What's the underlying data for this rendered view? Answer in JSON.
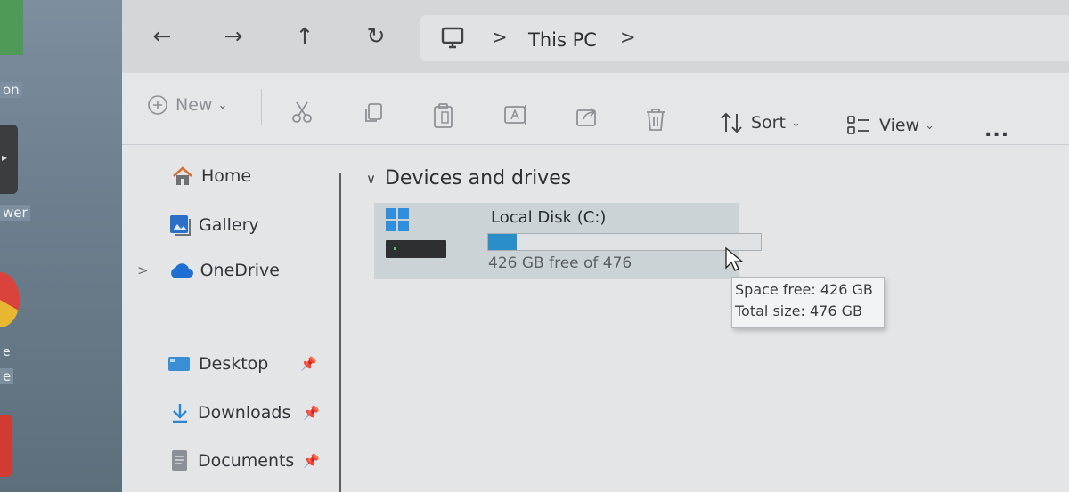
{
  "desktop": {
    "labels": [
      "on",
      "wer",
      "e",
      "e"
    ]
  },
  "nav_buttons": [
    "back",
    "forward",
    "up",
    "refresh"
  ],
  "address_bar": {
    "crumb": "This PC",
    "separator": ">"
  },
  "toolbar": {
    "new_label": "New",
    "sort_label": "Sort",
    "view_label": "View",
    "more_label": "..."
  },
  "nav_pane": {
    "items": [
      {
        "label": "Home",
        "icon": "home-icon",
        "pinned": false
      },
      {
        "label": "Gallery",
        "icon": "gallery-icon",
        "pinned": false
      },
      {
        "label": "OneDrive",
        "icon": "cloud-icon",
        "pinned": false,
        "expandable": true
      },
      {
        "label": "Desktop",
        "icon": "desktop-folder-icon",
        "pinned": true
      },
      {
        "label": "Downloads",
        "icon": "download-icon",
        "pinned": true
      },
      {
        "label": "Documents",
        "icon": "document-icon",
        "pinned": true
      }
    ]
  },
  "content": {
    "group_title": "Devices and drives",
    "drive": {
      "name": "Local Disk (C:)",
      "free_text": "426 GB free of 476",
      "used_fraction": 0.105
    },
    "tooltip": {
      "space_free": "Space free: 426 GB",
      "total_size": "Total size: 476 GB"
    }
  },
  "colors": {
    "accent": "#2a8ec8",
    "onedrive": "#1d6fd1",
    "home": "#d8703c"
  }
}
